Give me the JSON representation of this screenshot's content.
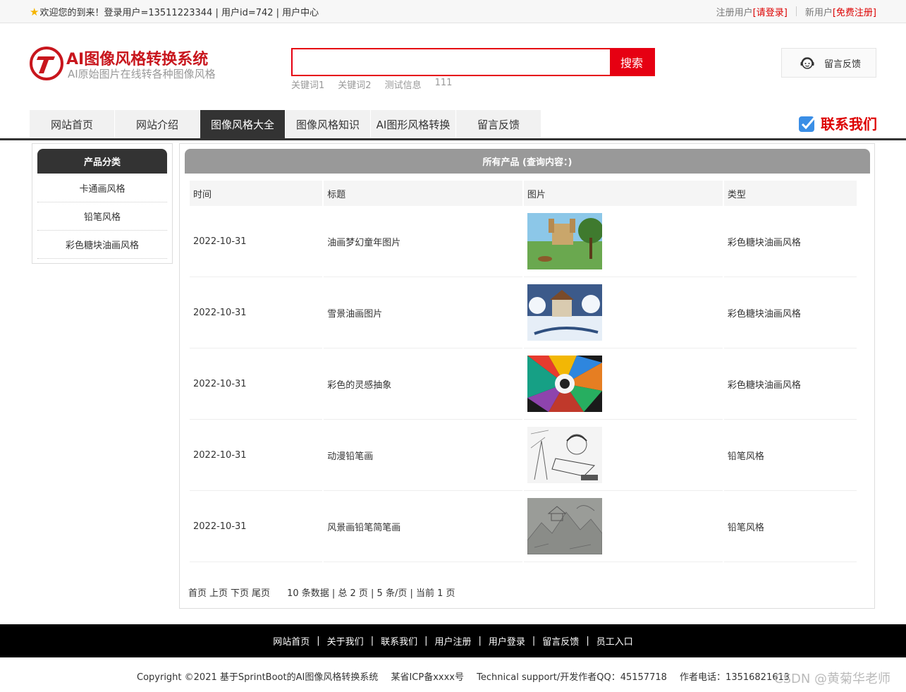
{
  "topbar": {
    "welcome": "欢迎您的到来！登录用户=13511223344 | 用户id=742 | 用户中心",
    "registered_label": "注册用户",
    "login_link": "[请登录]",
    "new_user_label": "新用户",
    "register_link": "[免费注册]"
  },
  "logo": {
    "title": "AI图像风格转换系统",
    "subtitle": "AI原始图片在线转各种图像风格"
  },
  "search": {
    "placeholder": "",
    "button": "搜索",
    "keywords": [
      "关键词1",
      "关键词2",
      "测试信息",
      "111"
    ]
  },
  "feedback_box": {
    "label": "留言反馈"
  },
  "nav": {
    "items": [
      "网站首页",
      "网站介绍",
      "图像风格大全",
      "图像风格知识",
      "AI图形风格转换",
      "留言反馈"
    ],
    "active_index": 2,
    "contact": "联系我们"
  },
  "sidebar": {
    "title": "产品分类",
    "categories": [
      "卡通画风格",
      "铅笔风格",
      "彩色糖块油画风格"
    ]
  },
  "main": {
    "title": "所有产品 (查询内容：)",
    "columns": [
      "时间",
      "标题",
      "图片",
      "类型"
    ],
    "rows": [
      {
        "time": "2022-10-31",
        "title": "油画梦幻童年图片",
        "type": "彩色糖块油画风格",
        "image": "castle-painting"
      },
      {
        "time": "2022-10-31",
        "title": "雪景油画图片",
        "type": "彩色糖块油画风格",
        "image": "snow-painting"
      },
      {
        "time": "2022-10-31",
        "title": "彩色的灵感抽象",
        "type": "彩色糖块油画风格",
        "image": "abstract-painting"
      },
      {
        "time": "2022-10-31",
        "title": "动漫铅笔画",
        "type": "铅笔风格",
        "image": "anime-sketch"
      },
      {
        "time": "2022-10-31",
        "title": "风景画铅笔简笔画",
        "type": "铅笔风格",
        "image": "landscape-sketch"
      }
    ],
    "pager": {
      "first": "首页",
      "prev": "上页",
      "next": "下页",
      "last": "尾页",
      "info": "10 条数据 | 总 2 页 | 5 条/页 | 当前 1 页"
    }
  },
  "footer": {
    "links": [
      "网站首页",
      "关于我们",
      "联系我们",
      "用户注册",
      "用户登录",
      "留言反馈",
      "员工入口"
    ],
    "copyright": "Copyright ©2021 基于SprintBoot的AI图像风格转换系统",
    "icp": "某省ICP备xxxx号",
    "support": "Technical support/开发作者QQ：45157718",
    "phone": "作者电话：13516821613",
    "watermark": "CSDN @黄菊华老师"
  },
  "colors": {
    "brand_red": "#c8161d",
    "search_red": "#e60012",
    "nav_dark": "#333333",
    "header_gray": "#999999"
  }
}
